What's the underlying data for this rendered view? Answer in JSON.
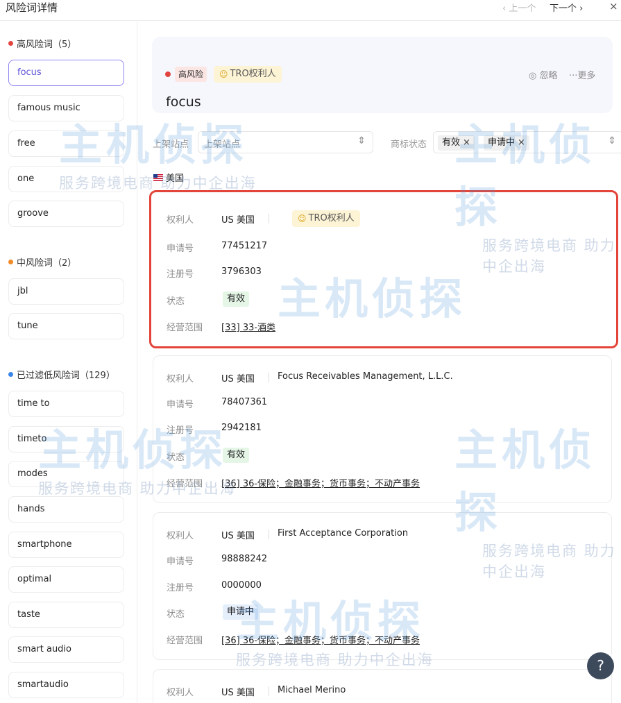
{
  "header": {
    "title": "风险词详情",
    "prev": "‹ 上一个",
    "next": "下一个 ›",
    "close": "×"
  },
  "sidebar": {
    "high": {
      "title": "高风险词（5）",
      "items": [
        "focus",
        "famous music",
        "free",
        "one",
        "groove"
      ]
    },
    "mid": {
      "title": "中风险词（2）",
      "items": [
        "jbl",
        "tune"
      ]
    },
    "low": {
      "title": "已过滤低风险词（129）",
      "items": [
        "time to",
        "timeto",
        "modes",
        "hands",
        "smartphone",
        "optimal",
        "taste",
        "smart audio",
        "smartaudio"
      ]
    }
  },
  "detail": {
    "risk_level": "高风险",
    "tro_tag": "TRO权利人",
    "ignore": "忽略",
    "more": "···更多",
    "word": "focus"
  },
  "filters": {
    "site_label": "上架站点",
    "site_placeholder": "上架站点",
    "status_label": "商标状态",
    "chips": [
      "有效",
      "申请中"
    ],
    "country": "美国"
  },
  "labels": {
    "owner": "权利人",
    "app_no": "申请号",
    "reg_no": "注册号",
    "status": "状态",
    "scope": "经营范围"
  },
  "records": [
    {
      "owner_country": "US 美国",
      "owner_name": "",
      "tro": "TRO权利人",
      "app_no": "77451217",
      "reg_no": "3796303",
      "status": "有效",
      "scope": "[33] 33-酒类"
    },
    {
      "owner_country": "US 美国",
      "owner_name": "Focus Receivables Management, L.L.C.",
      "app_no": "78407361",
      "reg_no": "2942181",
      "status": "有效",
      "scope": "[36] 36-保险；金融事务；货币事务；不动产事务"
    },
    {
      "owner_country": "US 美国",
      "owner_name": "First Acceptance Corporation",
      "app_no": "98888242",
      "reg_no": "0000000",
      "status": "申请中",
      "scope": "[36] 36-保险；金融事务；货币事务；不动产事务"
    },
    {
      "owner_country": "US 美国",
      "owner_name": "Michael Merino"
    }
  ],
  "watermark": {
    "brand": "主机侦探",
    "slogan": "服务跨境电商 助力中企出海"
  },
  "help": "?",
  "colors": {
    "accent": "#5e55d6",
    "high_risk": "#e2443f",
    "mid_risk": "#f28b27",
    "low_risk": "#3a86e8",
    "highlight_border": "#e3453a"
  }
}
